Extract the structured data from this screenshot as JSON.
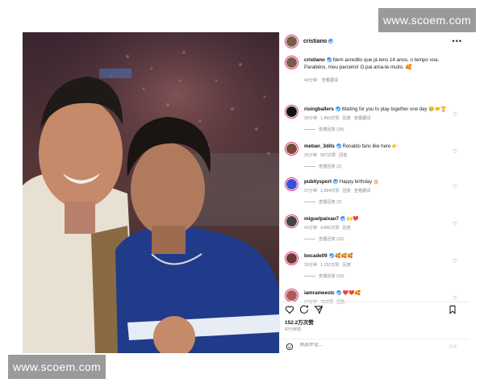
{
  "watermark": {
    "top_text": "www.scoem.com",
    "bottom_text": "www.scoem.com"
  },
  "post": {
    "author": "cristiano",
    "more_icon": "more-horizontal-icon"
  },
  "caption": {
    "username": "cristiano",
    "text": "Nem acredito que já tens 14 anos, o tempo voa. Parabéns, meu parceiro! O pai ama-te muito. 🥰",
    "time": "40分钟",
    "translate": "查看翻译"
  },
  "comments": [
    {
      "username": "risingballers",
      "text": "Waiting for you to play together one day 🥲🤝🏆",
      "time": "39分钟",
      "likes": "1,899次赞",
      "reply": "回复",
      "translate": "查看翻译",
      "replies": "查看回复 (18)",
      "avatar_color": "#111111"
    },
    {
      "username": "meban_3dits",
      "text": "Ronaldo fans like here 👉",
      "time": "35分钟",
      "likes": "587次赞",
      "reply": "回复",
      "translate": "",
      "replies": "查看回复 (2)",
      "avatar_color": "#7a4b3a"
    },
    {
      "username": "pubitysport",
      "text": "Happy birthday 🎂",
      "time": "37分钟",
      "likes": "1,084次赞",
      "reply": "回复",
      "translate": "查看翻译",
      "replies": "查看回复 (3)",
      "avatar_color": "#3a4fd8"
    },
    {
      "username": "miguelpaixao7",
      "text": "🙌❤️",
      "time": "41分钟",
      "likes": "4,865次赞",
      "reply": "回复",
      "translate": "",
      "replies": "查看回复 (23)",
      "avatar_color": "#444444"
    },
    {
      "username": "bocade09",
      "text": "🥰🥰🥰",
      "time": "39分钟",
      "likes": "1,152次赞",
      "reply": "回复",
      "translate": "",
      "replies": "查看回复 (19)",
      "avatar_color": "#6b3a3a"
    },
    {
      "username": "iamrameestc",
      "text": "❤️❤️🥰",
      "time": "37分钟",
      "likes": "49次赞",
      "reply": "回复",
      "translate": "",
      "replies": "",
      "avatar_color": "#b0585a"
    }
  ],
  "footer": {
    "likes": "152.2万次赞",
    "ago": "42分钟前",
    "comment_placeholder": "添加评论...",
    "post_label": "发布",
    "icons": [
      "heart-icon",
      "comment-icon",
      "share-icon",
      "bookmark-icon",
      "emoji-icon"
    ]
  },
  "colors": {
    "verified": "#3897f0",
    "story_ring": "#e1306c",
    "muted": "#8e8e8e"
  }
}
